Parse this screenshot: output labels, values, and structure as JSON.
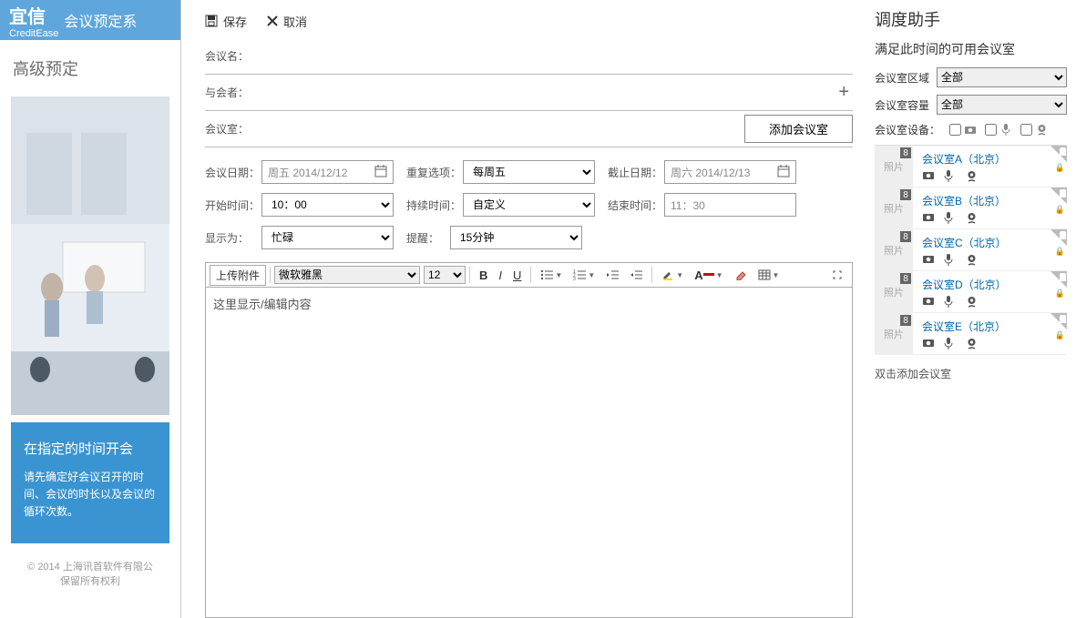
{
  "brand": {
    "cn": "宜信",
    "en": "CreditEase",
    "system": "会议预定系"
  },
  "sidebar": {
    "section": "高级预定",
    "panel_title": "在指定的时间开会",
    "panel_text": "请先确定好会议召开的时间、会议的时长以及会议的循环次数。",
    "copyright_1": "© 2014 上海讯首软件有限公",
    "copyright_2": "保留所有权利"
  },
  "toolbar": {
    "save": "保存",
    "cancel": "取消"
  },
  "form": {
    "meeting_name_label": "会议名：",
    "attendee_label": "与会者：",
    "room_label": "会议室：",
    "add_room_btn": "添加会议室",
    "date_label": "会议日期：",
    "date_value": "周五 2014/12/12",
    "repeat_label": "重复选项：",
    "repeat_value": "每周五",
    "until_label": "截止日期：",
    "until_value": "周六 2014/12/13",
    "start_label": "开始时间：",
    "start_value": "10：00",
    "duration_label": "持续时间：",
    "duration_value": "自定义",
    "end_label": "结束时间：",
    "end_value": "11：30",
    "showas_label": "显示为：",
    "showas_value": "忙碌",
    "remind_label": "提醒：",
    "remind_value": "15分钟"
  },
  "editor": {
    "upload": "上传附件",
    "font": "微软雅黑",
    "size": "12",
    "placeholder": "这里显示/编辑内容"
  },
  "assistant": {
    "title": "调度助手",
    "subtitle": "满足此时间的可用会议室",
    "region_label": "会议室区域",
    "region_value": "全部",
    "capacity_label": "会议室容量",
    "capacity_value": "全部",
    "equip_label": "会议室设备：",
    "photo_label": "照片",
    "badge": "8",
    "hint": "双击添加会议室",
    "rooms": [
      {
        "name": "会议室A（北京）"
      },
      {
        "name": "会议室B（北京）"
      },
      {
        "name": "会议室C（北京）"
      },
      {
        "name": "会议室D（北京）"
      },
      {
        "name": "会议室E（北京）"
      }
    ]
  }
}
